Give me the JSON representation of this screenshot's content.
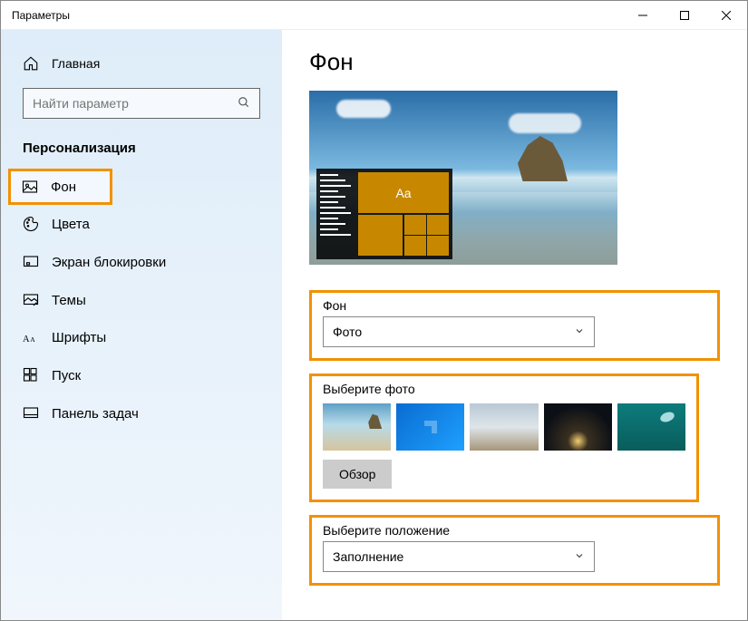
{
  "window": {
    "title": "Параметры"
  },
  "sidebar": {
    "home_label": "Главная",
    "search_placeholder": "Найти параметр",
    "category": "Персонализация",
    "items": [
      {
        "label": "Фон"
      },
      {
        "label": "Цвета"
      },
      {
        "label": "Экран блокировки"
      },
      {
        "label": "Темы"
      },
      {
        "label": "Шрифты"
      },
      {
        "label": "Пуск"
      },
      {
        "label": "Панель задач"
      }
    ]
  },
  "main": {
    "title": "Фон",
    "preview_tile_text": "Aa",
    "bg_section_label": "Фон",
    "bg_dropdown_value": "Фото",
    "choose_photo_label": "Выберите фото",
    "browse_label": "Обзор",
    "position_label": "Выберите положение",
    "position_value": "Заполнение"
  }
}
